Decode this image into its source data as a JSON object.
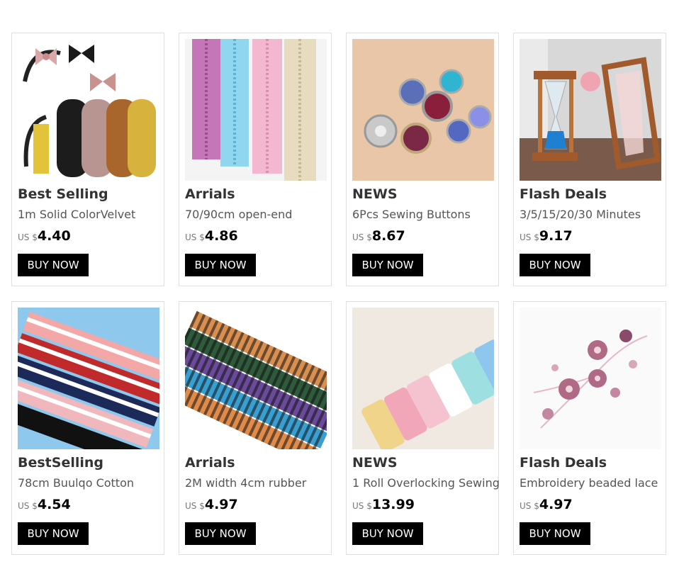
{
  "products": [
    {
      "category": "Best Selling",
      "name": "1m Solid ColorVelvet",
      "currency": "US $",
      "price": "4.40",
      "button": "BUY NOW",
      "image": "velvet-ribbons-headbands-image"
    },
    {
      "category": "Arrials",
      "name": "70/90cm open-end",
      "currency": "US $",
      "price": "4.86",
      "button": "BUY NOW",
      "image": "colored-zippers-image"
    },
    {
      "category": "NEWS",
      "name": "6Pcs Sewing Buttons",
      "currency": "US $",
      "price": "8.67",
      "button": "BUY NOW",
      "image": "crystal-buttons-image"
    },
    {
      "category": "Flash Deals",
      "name": "3/5/15/20/30 Minutes",
      "currency": "US $",
      "price": "9.17",
      "button": "BUY NOW",
      "image": "hourglass-timers-image"
    },
    {
      "category": "BestSelling",
      "name": "78cm Buulqo Cotton",
      "currency": "US $",
      "price": "4.54",
      "button": "BUY NOW",
      "image": "striped-rib-cuffs-image"
    },
    {
      "category": "Arrials",
      "name": "2M width 4cm rubber",
      "currency": "US $",
      "price": "4.97",
      "button": "BUY NOW",
      "image": "striped-elastic-bands-image"
    },
    {
      "category": "NEWS",
      "name": "1 Roll Overlocking Sewing",
      "currency": "US $",
      "price": "13.99",
      "button": "BUY NOW",
      "image": "thread-spools-image"
    },
    {
      "category": "Flash Deals",
      "name": "Embroidery beaded lace",
      "currency": "US $",
      "price": "4.97",
      "button": "BUY NOW",
      "image": "beaded-lace-flowers-image"
    }
  ]
}
